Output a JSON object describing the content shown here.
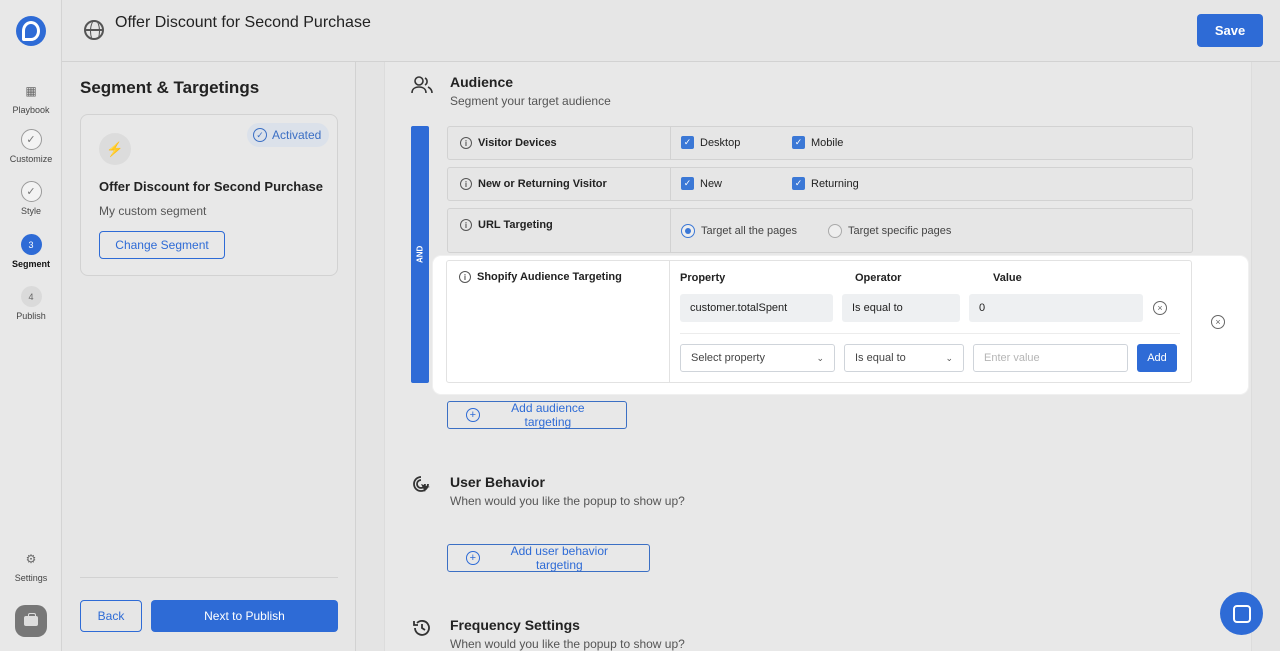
{
  "header": {
    "title": "Offer Discount for Second Purchase",
    "save_label": "Save"
  },
  "rail": {
    "items": [
      {
        "label": "Playbook",
        "icon": "grid-icon"
      },
      {
        "label": "Customize",
        "icon": "check-icon"
      },
      {
        "label": "Style",
        "icon": "check-icon"
      },
      {
        "label": "Segment",
        "step": "3"
      },
      {
        "label": "Publish",
        "step": "4"
      }
    ],
    "settings_label": "Settings"
  },
  "segment": {
    "heading": "Segment & Targetings",
    "badge": "Activated",
    "card_title": "Offer Discount for Second Purchase",
    "card_sub": "My custom segment",
    "change_label": "Change Segment",
    "back_label": "Back",
    "next_label": "Next to Publish"
  },
  "audience": {
    "title": "Audience",
    "subtitle": "Segment your target audience",
    "and_label": "AND",
    "rules": {
      "devices": {
        "name": "Visitor Devices",
        "opt1": "Desktop",
        "opt2": "Mobile"
      },
      "visitor": {
        "name": "New or Returning Visitor",
        "opt1": "New",
        "opt2": "Returning"
      },
      "url": {
        "name": "URL Targeting",
        "opt1": "Target all the pages",
        "opt2": "Target specific pages"
      }
    },
    "shopify": {
      "name": "Shopify Audience Targeting",
      "col_property": "Property",
      "col_operator": "Operator",
      "col_value": "Value",
      "row_property": "customer.totalSpent",
      "row_operator": "Is equal to",
      "row_value": "0",
      "new_property_placeholder": "Select property",
      "new_operator": "Is equal to",
      "new_value_placeholder": "Enter value",
      "add_label": "Add"
    },
    "add_targeting_label": "Add audience targeting"
  },
  "behavior": {
    "title": "User Behavior",
    "subtitle": "When would you like the popup to show up?",
    "add_label": "Add user behavior targeting"
  },
  "frequency": {
    "title": "Frequency Settings",
    "subtitle": "When would you like the popup to show up?"
  }
}
